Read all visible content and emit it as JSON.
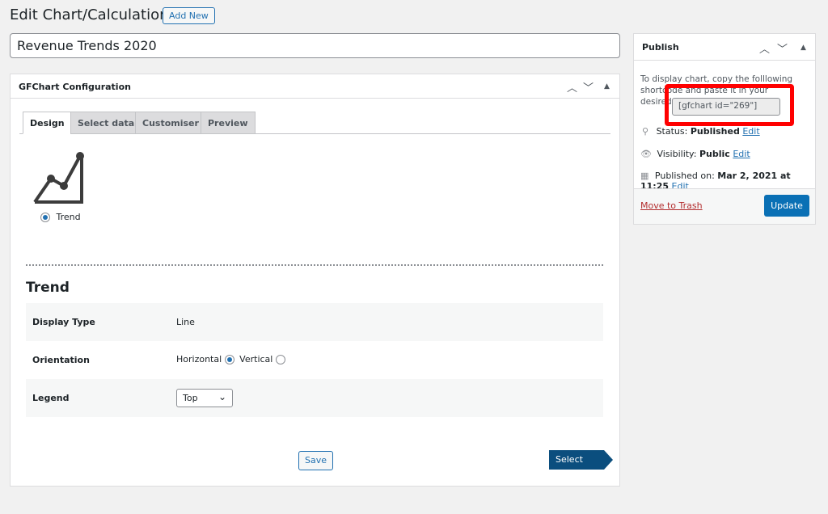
{
  "page": {
    "title": "Edit Chart/Calculation",
    "add_new": "Add New",
    "post_title": "Revenue Trends 2020"
  },
  "config": {
    "title": "GFChart Configuration",
    "tabs": [
      {
        "label": "Design"
      },
      {
        "label": "Select data"
      },
      {
        "label": "Customiser"
      },
      {
        "label": "Preview"
      }
    ],
    "chart_type": {
      "icon": "trend-chart-icon",
      "label": "Trend",
      "selected": true
    },
    "section_title": "Trend",
    "fields": {
      "display_type": {
        "label": "Display Type",
        "value": "Line"
      },
      "orientation": {
        "label": "Orientation",
        "options": [
          {
            "label": "Horizontal",
            "checked": true
          },
          {
            "label": "Vertical",
            "checked": false
          }
        ]
      },
      "legend": {
        "label": "Legend",
        "value": "Top"
      }
    },
    "save": "Save",
    "next": "Select data"
  },
  "publish": {
    "title": "Publish",
    "intro": "To display chart, copy the folllowing shortcode and paste it in your desired location.",
    "shortcode": "[gfchart id=\"269\"]",
    "status_label": "Status:",
    "status": "Published",
    "visibility_label": "Visibility:",
    "visibility": "Public",
    "published_label": "Published on:",
    "published": "Mar 2, 2021 at 11:25",
    "edit": "Edit",
    "trash": "Move to Trash",
    "update": "Update"
  },
  "colors": {
    "accent": "#2271b1",
    "highlight": "#ff0000",
    "primary_btn": "#0a70b5",
    "next_btn": "#0b4e7e"
  }
}
